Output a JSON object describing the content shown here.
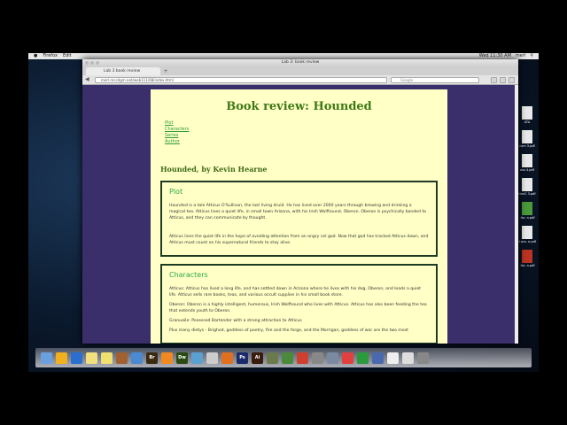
{
  "menubar": {
    "app": "Firefox",
    "menu": "Edit",
    "clock": "Wed 11:30 AM",
    "user": "merl"
  },
  "window": {
    "title": "Lab 3: book review",
    "tab": "Lab 3 book review",
    "new_tab": "+",
    "url": "merl.mccdgm.net/web111/08/index.html",
    "search_placeholder": "Google"
  },
  "page": {
    "title": "Book review: Hounded",
    "toc": [
      "Plot",
      "Characters",
      "Series",
      "Author"
    ],
    "subtitle": "Hounded, by Kevin Hearne",
    "plot": {
      "heading": "Plot",
      "p1": "Hounded is a tale Atticus O'Sullivan, the last living druid. He has lived over 2000 years through brewing and drinking a magical tea. Atticus lives a quiet life, in small town Arizona, with his Irish Wolfhound, Oberon. Oberon is psychically bonded to Atticus, and they can communicate by thought.",
      "p2": "Atticus lives the quiet life in the hope of avoiding attention from an angry cel god. Now that god has tracked Atticus down, and Atticus must count on his supernatural friends to stay alive."
    },
    "characters": {
      "heading": "Characters",
      "p1": "Atticus: Atticus has lived a long life, and has settled down in Arizona where he lives with his dog, Oberon, and leads a quiet life. Atticus sells rare books, teas, and various occult supplies in his small book store.",
      "p2": "Oberon: Oberon is a highly intelligent, humerous, Irish Wolfhound who lives with Atticus. Atticus has also been feeding the tea that extends youth to Oberon.",
      "p3": "Granuaile: Posessed Bartender with a strong attraction to Atticus",
      "p4": "Plus many dietys - Brighod, goddess of poetry, fire and the forge, and the Morrigan, goddess of war are the two most"
    }
  },
  "dock": [
    "Finder",
    "Dashboard",
    "Word",
    "Notes",
    "Stickies",
    "Preview",
    "Xcode",
    "Br",
    "Settings",
    "Dw",
    "Safari",
    "Files",
    "Firefox",
    "Ps",
    "Ai",
    "Compressor",
    "Utility",
    "Chrome",
    "Photo",
    "iPhoto",
    "Acrobat",
    "Excel",
    "Info",
    "Docs",
    "Downloads",
    "Trash"
  ],
  "desktop_files": [
    "ATA",
    "com 3.pdf",
    "oss 4.pdf",
    "tionC 3.pdf",
    "-for- n.pdf",
    "+pro- n.pdf",
    "-for- n.pdf"
  ]
}
